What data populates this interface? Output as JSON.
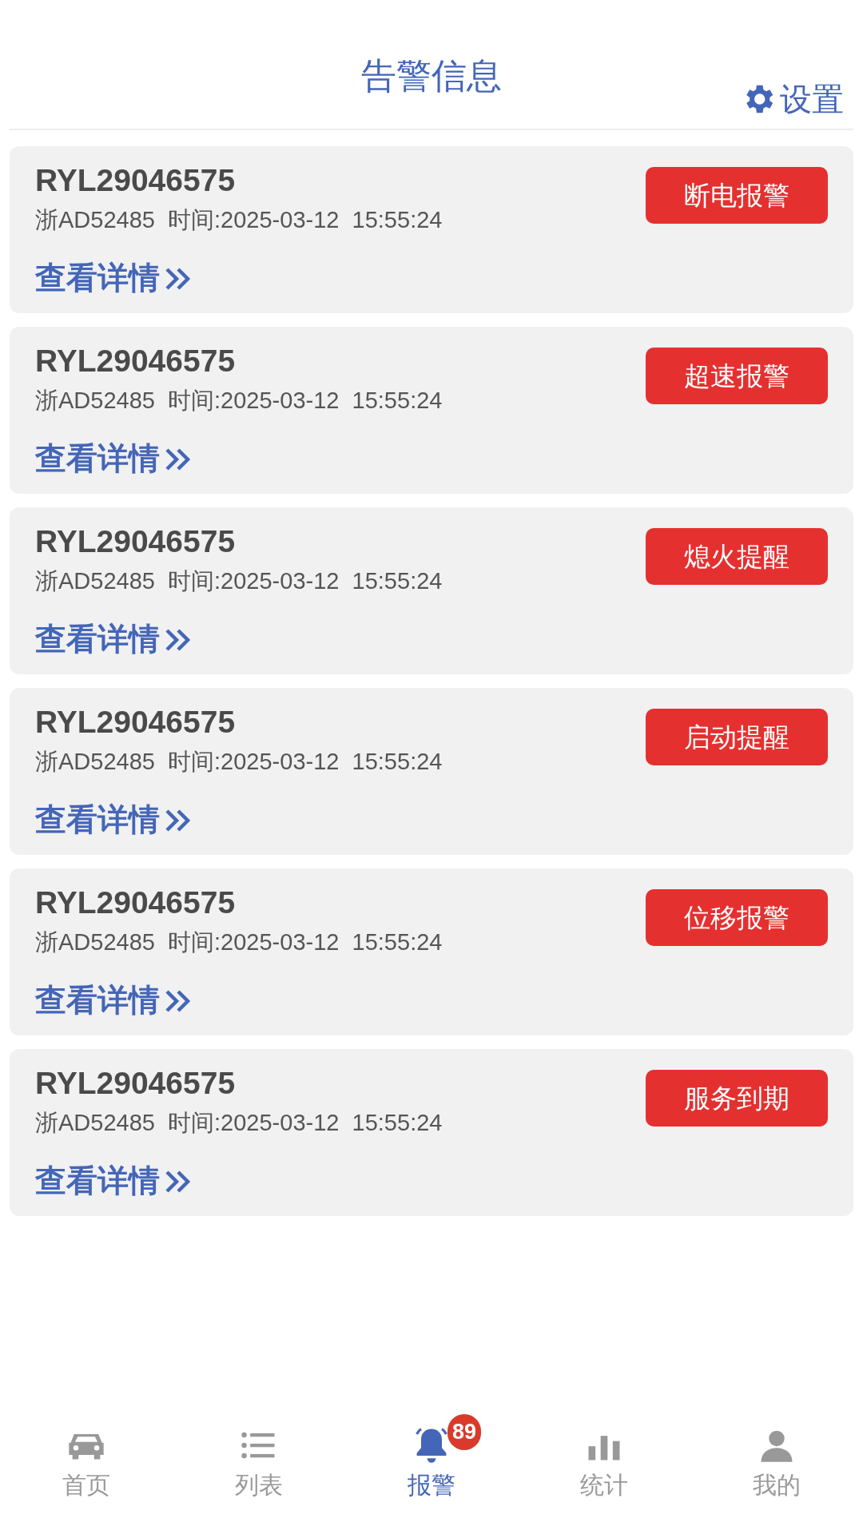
{
  "header": {
    "title": "告警信息",
    "settings": "设置"
  },
  "alerts": [
    {
      "device": "RYL29046575",
      "plate": "浙AD52485",
      "time": "时间:2025-03-12  15:55:24",
      "tag": "断电报警",
      "link": "查看详情"
    },
    {
      "device": "RYL29046575",
      "plate": "浙AD52485",
      "time": "时间:2025-03-12  15:55:24",
      "tag": "超速报警",
      "link": "查看详情"
    },
    {
      "device": "RYL29046575",
      "plate": "浙AD52485",
      "time": "时间:2025-03-12  15:55:24",
      "tag": "熄火提醒",
      "link": "查看详情"
    },
    {
      "device": "RYL29046575",
      "plate": "浙AD52485",
      "time": "时间:2025-03-12  15:55:24",
      "tag": "启动提醒",
      "link": "查看详情"
    },
    {
      "device": "RYL29046575",
      "plate": "浙AD52485",
      "time": "时间:2025-03-12  15:55:24",
      "tag": "位移报警",
      "link": "查看详情"
    },
    {
      "device": "RYL29046575",
      "plate": "浙AD52485",
      "time": "时间:2025-03-12  15:55:24",
      "tag": "服务到期",
      "link": "查看详情"
    }
  ],
  "tabs": [
    {
      "kind": "car",
      "label": "首页",
      "selected": false
    },
    {
      "kind": "list",
      "label": "列表",
      "selected": false
    },
    {
      "kind": "bell",
      "label": "报警",
      "selected": true,
      "badge": "89"
    },
    {
      "kind": "chart",
      "label": "统计",
      "selected": false
    },
    {
      "kind": "person",
      "label": "我的",
      "selected": false
    }
  ]
}
